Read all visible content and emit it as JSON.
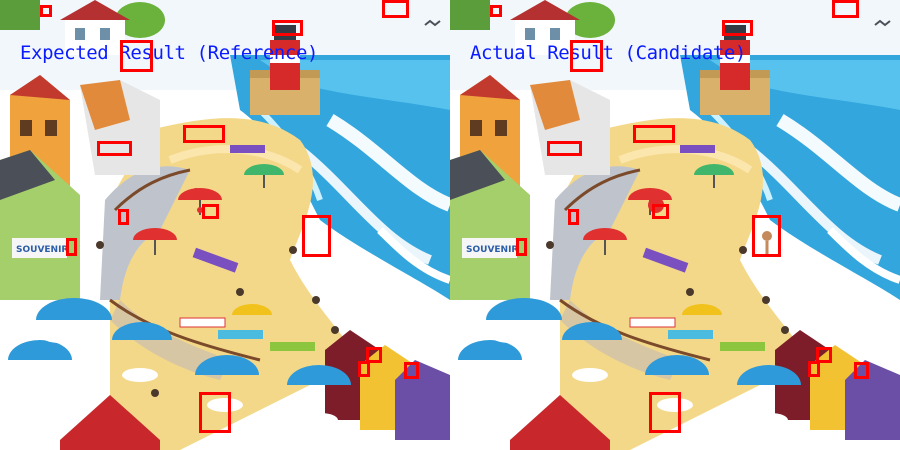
{
  "left_panel": {
    "caption": "Expected Result (Reference)",
    "sign_text": "SOUVENIR"
  },
  "right_panel": {
    "caption": "Actual Result (Candidate)",
    "sign_text": "SOUVENIR"
  },
  "colors": {
    "caption": "#0a1cff",
    "highlight": "#ff0000",
    "sea": "#33a6dd",
    "sand": "#f4d889"
  }
}
